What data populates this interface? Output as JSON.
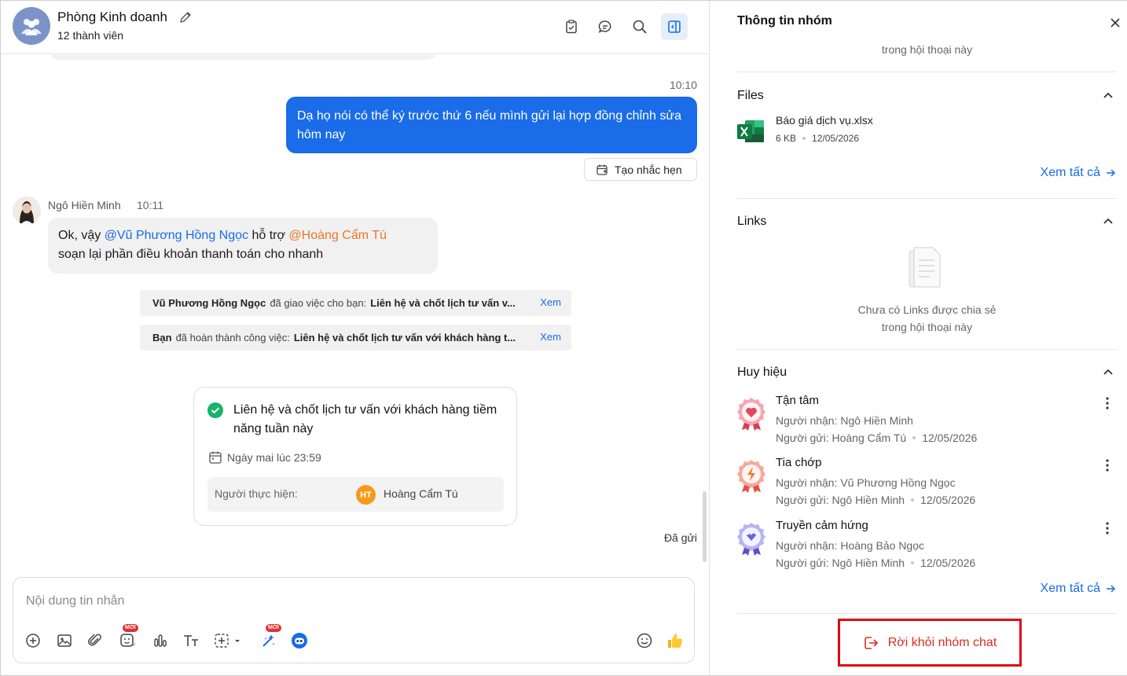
{
  "header": {
    "title": "Phòng Kinh doanh",
    "subtitle": "12 thành viên"
  },
  "messages": {
    "my_time": "10:10",
    "my_text": "Dạ họ nói có thể ký trước thứ 6 nếu mình gửi lại hợp đồng chỉnh sửa hôm nay",
    "remind_label": "Tạo nhắc hẹn",
    "sender_name": "Ngô Hiền Minh",
    "sender_time": "10:11",
    "other_text": {
      "prefix": "Ok, vậy ",
      "mention1": "@Vũ Phương Hồng Ngọc",
      "middle": " hỗ trợ ",
      "mention2": "@Hoàng Cẩm Tú",
      "line2": "soạn lại phần điều khoản thanh toán cho nhanh"
    },
    "notices": [
      {
        "actor": "Vũ Phương Hồng Ngọc",
        "action": "đã giao việc cho bạn:",
        "task": "Liên hệ và chốt lịch tư vấn v...",
        "link": "Xem"
      },
      {
        "actor": "Bạn",
        "action": "đã hoàn thành công việc:",
        "task": "Liên hệ và chốt lịch tư vấn với khách hàng t...",
        "link": "Xem"
      }
    ],
    "task": {
      "title": "Liên hệ và chốt lịch tư vấn với khách hàng tiềm năng tuần này",
      "due": "Ngày mai lúc 23:59",
      "assignee_label": "Người thực hiện:",
      "assignee_initials": "HT",
      "assignee_name": "Hoàng Cẩm Tú"
    },
    "status": "Đã gửi"
  },
  "composer": {
    "placeholder": "Nội dung tin nhắn",
    "new_badge": "MỚI"
  },
  "info": {
    "title": "Thông tin nhóm",
    "media_empty_line2": "trong hội thoại này",
    "files": {
      "title": "Files",
      "items": [
        {
          "name": "Báo giá dịch vụ.xlsx",
          "size": "6 KB",
          "date": "12/05/2026"
        }
      ],
      "see_all": "Xem tất cả"
    },
    "links": {
      "title": "Links",
      "empty_line1": "Chưa có Links được chia sẻ",
      "empty_line2": "trong hội thoại này"
    },
    "badges": {
      "title": "Huy hiệu",
      "items": [
        {
          "name": "Tận tâm",
          "receiver": "Người nhận: Ngô Hiền Minh",
          "sender": "Người gửi: Hoàng Cẩm Tú",
          "date": "12/05/2026",
          "color": "#e8455a"
        },
        {
          "name": "Tia chớp",
          "receiver": "Người nhận: Vũ Phương Hồng Ngọc",
          "sender": "Người gửi: Ngô Hiền Minh",
          "date": "12/05/2026",
          "color": "#ef5a4c"
        },
        {
          "name": "Truyền cảm hứng",
          "receiver": "Người nhận: Hoàng Bảo Ngọc",
          "sender": "Người gửi: Ngô Hiền Minh",
          "date": "12/05/2026",
          "color": "#6b63d9"
        }
      ],
      "see_all": "Xem tất cả"
    },
    "leave_label": "Rời khỏi nhóm chat"
  }
}
